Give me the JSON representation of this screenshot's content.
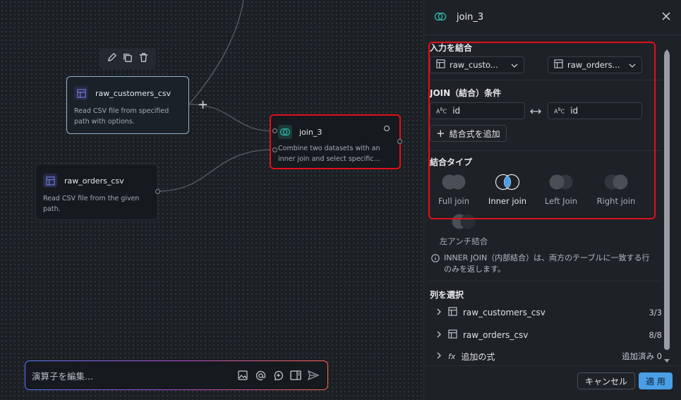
{
  "canvas": {
    "nodes": {
      "customers": {
        "title": "raw_customers_csv",
        "description": "Read CSV file from specified path with options."
      },
      "orders": {
        "title": "raw_orders_csv",
        "description": "Read CSV file from the given path."
      },
      "join": {
        "title": "join_3",
        "description": "Combine two datasets with an inner join and select specific..."
      }
    },
    "prompt": {
      "placeholder": "演算子を編集..."
    }
  },
  "panel": {
    "title": "join_3",
    "inputs": {
      "section_title": "入力を結合",
      "left_value": "raw_custo...",
      "right_value": "raw_orders..."
    },
    "condition": {
      "section_title": "JOIN（結合）条件",
      "left_field": "id",
      "right_field": "id",
      "add_label": "結合式を追加"
    },
    "join_type": {
      "section_title": "結合タイプ",
      "options": [
        {
          "label": "Full join"
        },
        {
          "label": "Inner join"
        },
        {
          "label": "Left Join"
        },
        {
          "label": "Right join"
        },
        {
          "label": "左アンチ結合"
        }
      ],
      "selected": "Inner join",
      "info": "INNER JOIN（内部結合）は、両方のテーブルに一致する行のみを返します。"
    },
    "columns": {
      "section_title": "列を選択",
      "rows": [
        {
          "name": "raw_customers_csv",
          "count": "3/3"
        },
        {
          "name": "raw_orders_csv",
          "count": "8/8"
        },
        {
          "name": "追加の式",
          "count": "追加済み 0"
        }
      ]
    },
    "footer": {
      "cancel_label": "キャンセル",
      "apply_label": "適 用"
    }
  },
  "colors": {
    "accent": "#4a9fe6",
    "highlight": "#e0101a",
    "teal": "#2fb3a0"
  }
}
